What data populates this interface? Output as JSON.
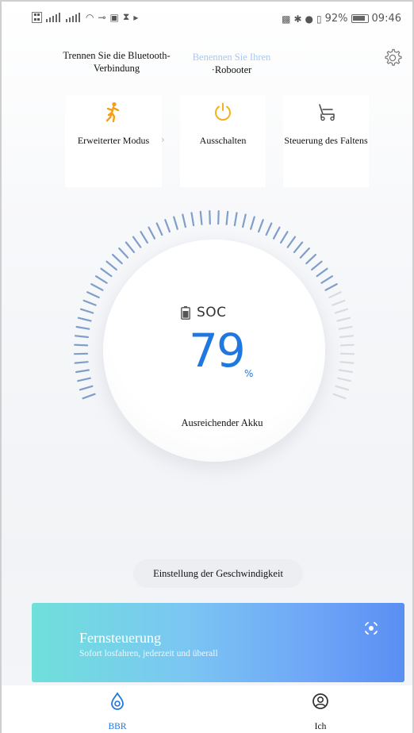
{
  "status_bar": {
    "icons_left": [
      "sim-icon",
      "signal-icon",
      "signal-icon",
      "wifi-icon",
      "key-icon",
      "nfc-icon",
      "hourglass-icon",
      "cast-icon"
    ],
    "icons_right": [
      "vibrate-icon",
      "bluetooth-icon",
      "location-icon",
      "vibration-icon"
    ],
    "battery_percent": "92%",
    "time": "09:46"
  },
  "header": {
    "disconnect_label": "Trennen Sie die Bluetooth-Verbindung",
    "rename_label": "Benennen Sie Ihren",
    "device_name": "·Robooter"
  },
  "tiles": [
    {
      "icon": "walking-person-icon",
      "label": "Erweiterter Modus"
    },
    {
      "icon": "power-icon",
      "label": "Ausschalten"
    },
    {
      "icon": "wheelchair-fold-icon",
      "label": "Steuerung des Faltens"
    }
  ],
  "gauge": {
    "label": "SOC",
    "value": "79",
    "unit": "%",
    "level_fraction": 0.79,
    "status_text": "Ausreichender Akku"
  },
  "speed_button_label": "Einstellung der Geschwindigkeit",
  "remote": {
    "title": "Fernsteuerung",
    "subtitle": "Sofort losfahren, jederzeit und überall"
  },
  "nav": [
    {
      "label": "BBR",
      "active": true
    },
    {
      "label": "Ich",
      "active": false
    }
  ],
  "colors": {
    "accent": "#1f78e0",
    "walk_icon": "#f2a018",
    "power_icon": "#f2b21c",
    "gauge_tick_active": "#7f9ec9",
    "gauge_tick_inactive": "#d8dbe0"
  }
}
